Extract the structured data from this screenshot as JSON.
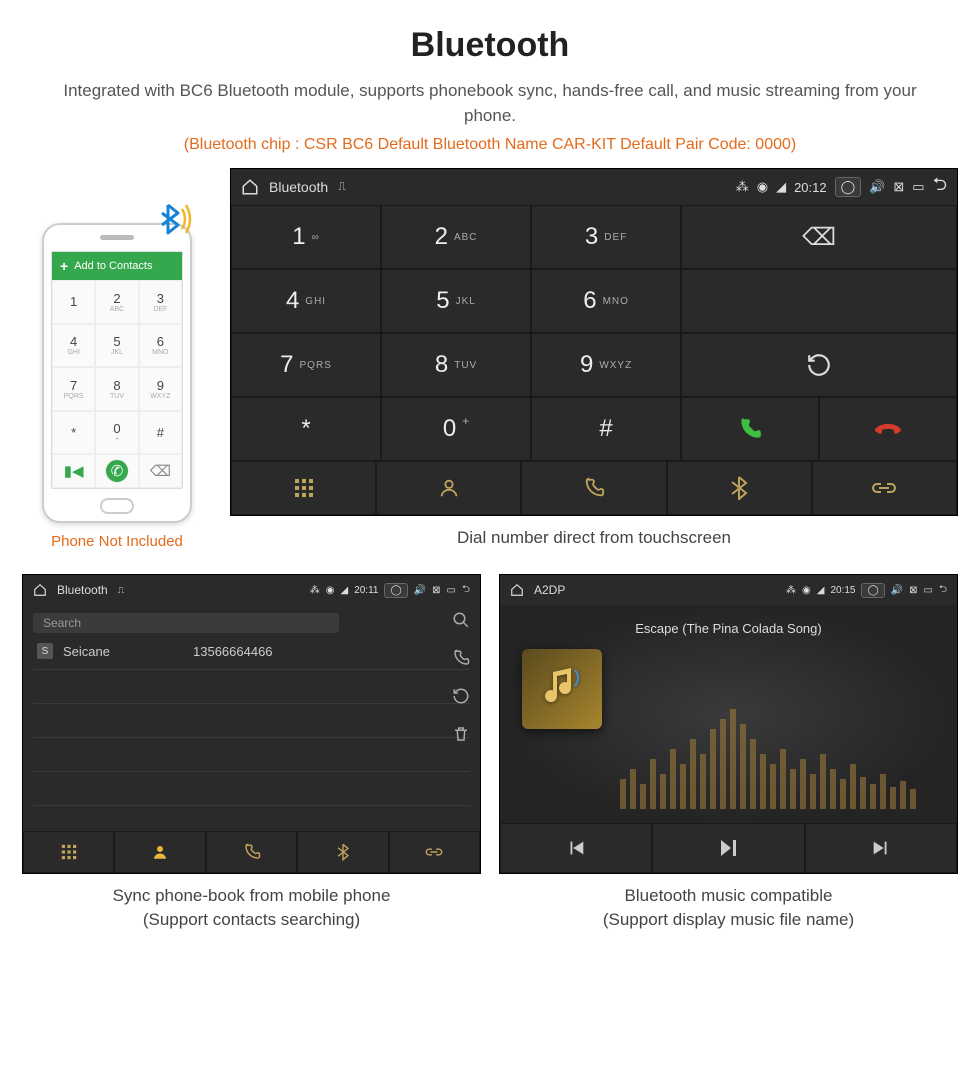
{
  "header": {
    "title": "Bluetooth",
    "intro": "Integrated with BC6 Bluetooth module, supports phonebook sync, hands-free call, and music streaming from your phone.",
    "spec": "(Bluetooth chip : CSR BC6     Default Bluetooth Name CAR-KIT     Default Pair Code: 0000)"
  },
  "phone_mock": {
    "add_contacts": "Add to Contacts",
    "caption": "Phone Not Included"
  },
  "dialer": {
    "statusbar": {
      "title": "Bluetooth",
      "time": "20:12"
    },
    "keys": [
      {
        "num": "1",
        "ltr": "∞"
      },
      {
        "num": "2",
        "ltr": "ABC"
      },
      {
        "num": "3",
        "ltr": "DEF"
      },
      {
        "num": "4",
        "ltr": "GHI"
      },
      {
        "num": "5",
        "ltr": "JKL"
      },
      {
        "num": "6",
        "ltr": "MNO"
      },
      {
        "num": "7",
        "ltr": "PQRS"
      },
      {
        "num": "8",
        "ltr": "TUV"
      },
      {
        "num": "9",
        "ltr": "WXYZ"
      },
      {
        "num": "*",
        "ltr": ""
      },
      {
        "num": "0",
        "ltr": "+"
      },
      {
        "num": "#",
        "ltr": ""
      }
    ],
    "caption": "Dial number direct from touchscreen"
  },
  "contacts": {
    "statusbar": {
      "title": "Bluetooth",
      "time": "20:11"
    },
    "search_placeholder": "Search",
    "row": {
      "initial": "S",
      "name": "Seicane",
      "number": "13566664466"
    },
    "caption_l1": "Sync phone-book from mobile phone",
    "caption_l2": "(Support contacts searching)"
  },
  "music": {
    "statusbar": {
      "title": "A2DP",
      "time": "20:15"
    },
    "song": "Escape (The Pina Colada Song)",
    "caption_l1": "Bluetooth music compatible",
    "caption_l2": "(Support display music file name)"
  }
}
